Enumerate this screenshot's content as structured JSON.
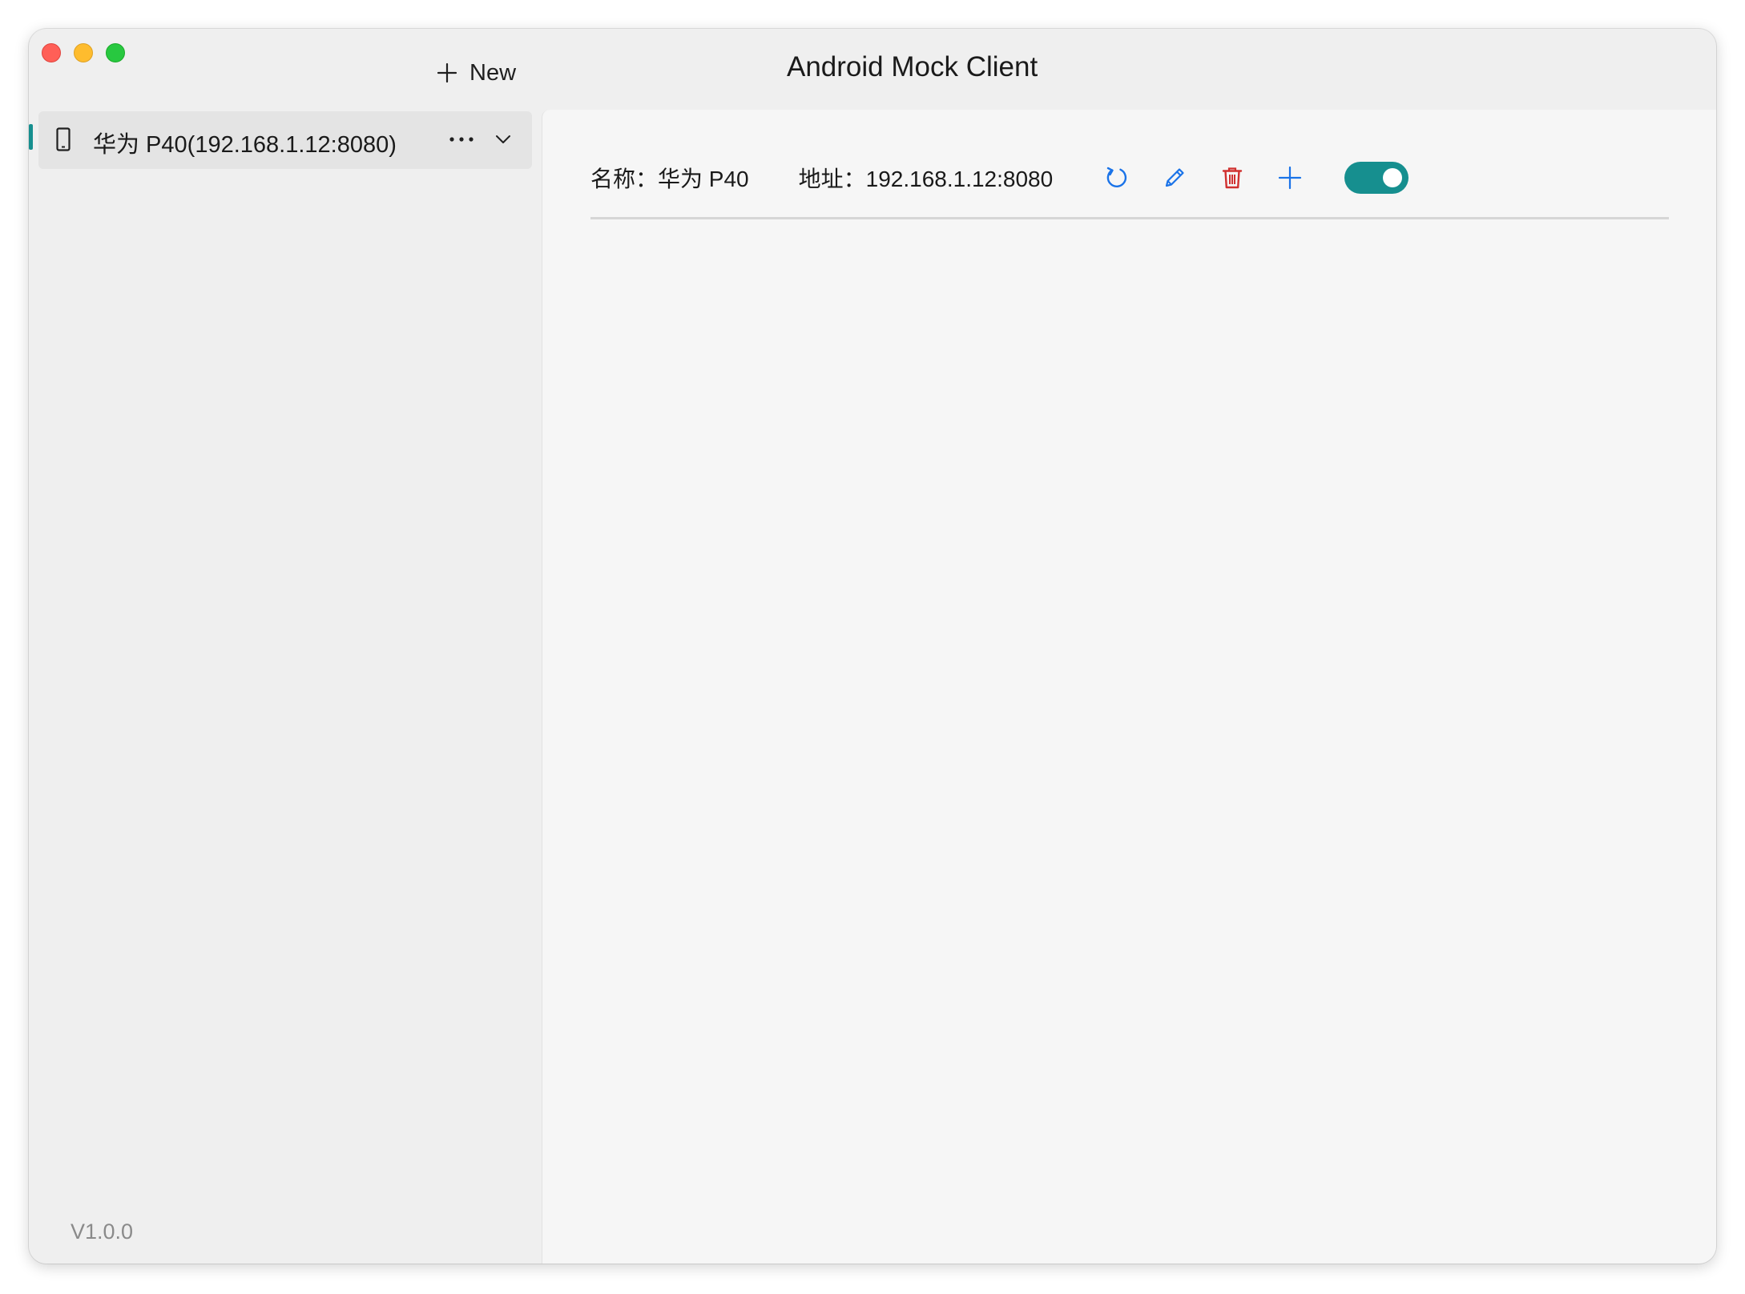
{
  "window": {
    "title": "Android Mock Client"
  },
  "toolbar": {
    "new_label": "New"
  },
  "sidebar": {
    "devices": [
      {
        "label": "华为 P40(192.168.1.12:8080)",
        "selected": true
      }
    ],
    "version": "V1.0.0"
  },
  "detail": {
    "name_label": "名称：",
    "name_value": "华为 P40",
    "address_label": "地址：",
    "address_value": "192.168.1.12:8080",
    "actions": [
      "refresh-icon",
      "edit-icon",
      "delete-icon",
      "add-icon"
    ],
    "enabled": true
  },
  "colors": {
    "accent": "#168f8f",
    "action_blue": "#1a73e8",
    "danger_red": "#d0302f"
  }
}
